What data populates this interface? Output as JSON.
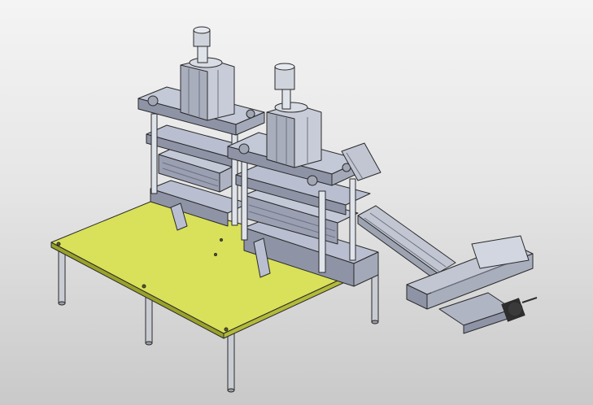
{
  "viewport": {
    "background": [
      "#f4f4f4",
      "#e6e6e6",
      "#c9c9c9"
    ]
  },
  "model": {
    "parts": [
      "table-top",
      "table-leg",
      "press-die-set",
      "guide-pillar",
      "pneumatic-cylinder",
      "mounting-bracket",
      "linear-rail-module",
      "cross-slide-module",
      "stepper-motor"
    ],
    "colors": {
      "table_top": "#d9e05a",
      "table_edge": "#9aa12a",
      "steel_plate": "#b9bfd0",
      "steel_plate_dark": "#8e94a6",
      "cylinder_body": "#c8ccd8",
      "rod": "#dfe3ea",
      "rail": "#c2c6d2",
      "motor": "#2e2e2e",
      "outline": "#2a2a2a"
    }
  }
}
